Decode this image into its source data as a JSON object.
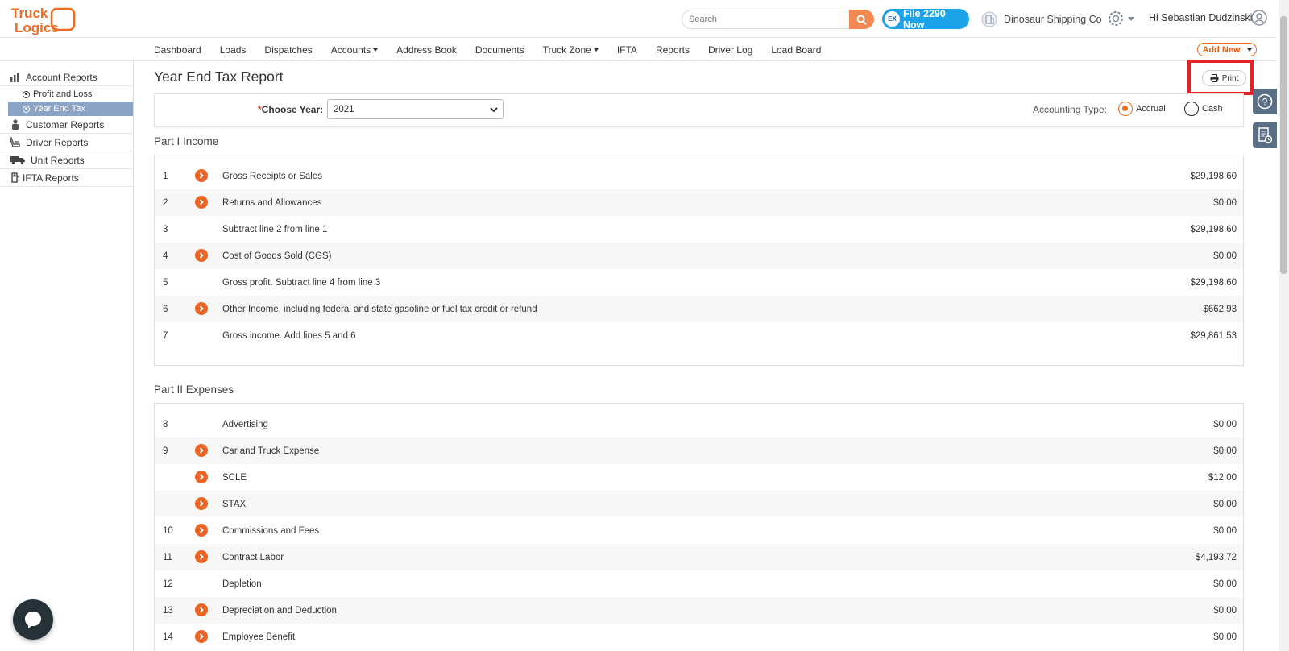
{
  "header": {
    "logo_text": "Truck Logics",
    "search_placeholder": "Search",
    "file2290_label": "File 2290 Now",
    "file2290_badge": "EX",
    "company": "Dinosaur Shipping Co",
    "greeting": "Hi Sebastian Dudzinski"
  },
  "nav": {
    "items": [
      "Dashboard",
      "Loads",
      "Dispatches",
      "Accounts",
      "Address Book",
      "Documents",
      "Truck Zone",
      "IFTA",
      "Reports",
      "Driver Log",
      "Load Board"
    ],
    "add_new": "Add New"
  },
  "sidebar": {
    "account_reports": "Account Reports",
    "profit_and_loss": "Profit and Loss",
    "year_end_tax": "Year End Tax",
    "customer_reports": "Customer Reports",
    "driver_reports": "Driver Reports",
    "unit_reports": "Unit Reports",
    "ifta_reports": "IFTA Reports"
  },
  "page": {
    "title": "Year End Tax Report",
    "print_label": "Print"
  },
  "filter": {
    "year_label": "Choose Year:",
    "year_required_mark": "*",
    "year_value": "2021",
    "accounting_label": "Accounting Type:",
    "accrual": "Accrual",
    "cash": "Cash",
    "selected": "Accrual"
  },
  "part1": {
    "title": "Part I Income",
    "rows": [
      {
        "num": "1",
        "arrow": true,
        "desc": "Gross Receipts or Sales",
        "amount": "$29,198.60"
      },
      {
        "num": "2",
        "arrow": true,
        "desc": "Returns and Allowances",
        "amount": "$0.00"
      },
      {
        "num": "3",
        "arrow": false,
        "desc": "Subtract line 2 from line 1",
        "amount": "$29,198.60"
      },
      {
        "num": "4",
        "arrow": true,
        "desc": "Cost of Goods Sold (CGS)",
        "amount": "$0.00"
      },
      {
        "num": "5",
        "arrow": false,
        "desc": "Gross profit. Subtract line 4 from line 3",
        "amount": "$29,198.60"
      },
      {
        "num": "6",
        "arrow": true,
        "desc": "Other Income, including federal and state gasoline or fuel tax credit or refund",
        "amount": "$662.93"
      },
      {
        "num": "7",
        "arrow": false,
        "desc": "Gross income. Add lines 5 and 6",
        "amount": "$29,861.53"
      }
    ]
  },
  "part2": {
    "title": "Part II Expenses",
    "rows": [
      {
        "num": "8",
        "arrow": false,
        "desc": "Advertising",
        "amount": "$0.00"
      },
      {
        "num": "9",
        "arrow": true,
        "desc": "Car and Truck Expense",
        "amount": "$0.00"
      },
      {
        "num": "",
        "arrow": true,
        "desc": "SCLE",
        "amount": "$12.00"
      },
      {
        "num": "",
        "arrow": true,
        "desc": "STAX",
        "amount": "$0.00"
      },
      {
        "num": "10",
        "arrow": true,
        "desc": "Commissions and Fees",
        "amount": "$0.00"
      },
      {
        "num": "11",
        "arrow": true,
        "desc": "Contract Labor",
        "amount": "$4,193.72"
      },
      {
        "num": "12",
        "arrow": false,
        "desc": "Depletion",
        "amount": "$0.00"
      },
      {
        "num": "13",
        "arrow": true,
        "desc": "Depreciation and Deduction",
        "amount": "$0.00"
      },
      {
        "num": "14",
        "arrow": true,
        "desc": "Employee Benefit",
        "amount": "$0.00"
      }
    ]
  },
  "colors": {
    "accent": "#ee6523",
    "file2290": "#1aa3e8",
    "sidebar_active": "#8ba3c4",
    "highlight": "#e8202a"
  }
}
